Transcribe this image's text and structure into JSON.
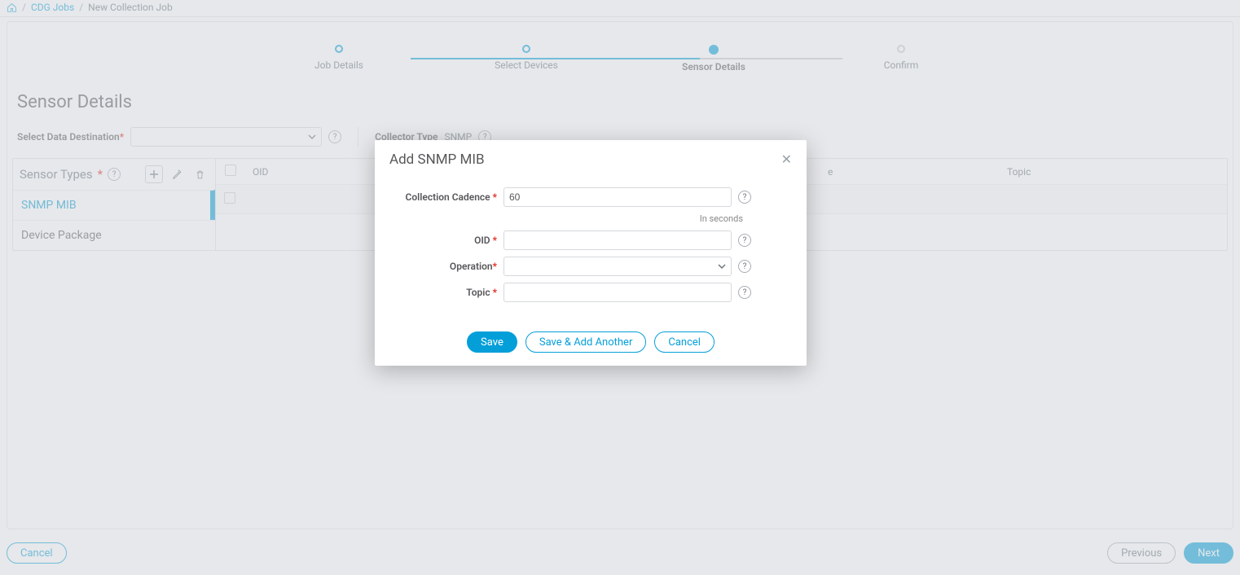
{
  "breadcrumb": {
    "link": "CDG Jobs",
    "current": "New Collection Job"
  },
  "stepper": {
    "s1": "Job Details",
    "s2": "Select Devices",
    "s3": "Sensor Details",
    "s4": "Confirm"
  },
  "page_title": "Sensor Details",
  "dest_label": "Select Data Destination",
  "collector_type_label": "Collector Type",
  "collector_type_value": "SNMP",
  "sensor_types_label": "Sensor Types",
  "sensor_items": {
    "i0": "SNMP MIB",
    "i1": "Device Package"
  },
  "table": {
    "col_oid": "OID",
    "col_other": "e",
    "col_topic": "Topic"
  },
  "footer": {
    "cancel": "Cancel",
    "previous": "Previous",
    "next": "Next"
  },
  "modal": {
    "title": "Add SNMP MIB",
    "cadence_label": "Collection Cadence",
    "cadence_value": "60",
    "cadence_hint": "In seconds",
    "oid_label": "OID",
    "operation_label": "Operation",
    "topic_label": "Topic",
    "save": "Save",
    "save_another": "Save & Add Another",
    "cancel": "Cancel"
  }
}
